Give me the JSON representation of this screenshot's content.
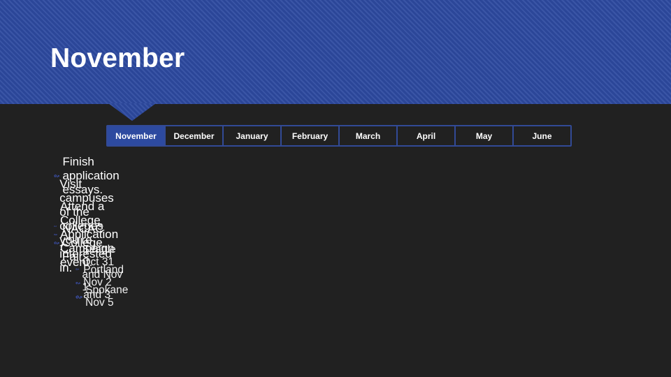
{
  "slide": {
    "title": "November",
    "accent_color": "#2d4aa0",
    "background_color": "#212121"
  },
  "timeline": {
    "active_index": 0,
    "months": [
      "November",
      "December",
      "January",
      "February",
      "March",
      "April",
      "May",
      "June"
    ]
  },
  "bullets": [
    {
      "icon": "flourish-bullet-icon",
      "text": "Finish application essays."
    },
    {
      "icon": "flourish-bullet-icon",
      "text": "Visit campuses of the colleges you’re interested in."
    },
    {
      "icon": "flourish-bullet-icon",
      "text": "Attend a College Application Campaign event."
    },
    {
      "icon": "flourish-bullet-icon",
      "text": "NACAC College Fair",
      "sub_items": [
        {
          "icon": "flourish-bullet-icon",
          "text": "Seattle Oct 31 and Nov 1"
        },
        {
          "icon": "flourish-bullet-icon",
          "text": "Portland Nov 2 and 3"
        },
        {
          "icon": "flourish-bullet-icon",
          "text": "Spokane Nov 5"
        }
      ]
    }
  ]
}
